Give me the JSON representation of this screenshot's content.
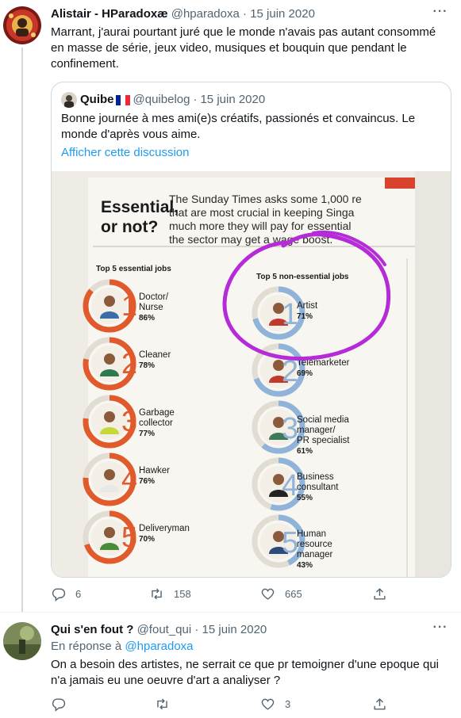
{
  "tweet1": {
    "name": "Alistair - HParadoxæ",
    "handle": "@hparadoxa",
    "separator": "·",
    "date": "15 juin 2020",
    "text": "Marrant, j'aurai pourtant juré que le monde n'avais pas autant consommé en masse de série, jeux video, musiques et bouquin que pendant le confinement.",
    "more_icon": "more-icon",
    "quote": {
      "name": "Quibe",
      "handle": "@quibelog",
      "separator": "·",
      "date": "15 juin 2020",
      "text": "Bonne journée à mes ami(e)s créatifs, passionés et convaincus. Le monde d'après vous aime.",
      "link": "Afficher cette discussion",
      "image": {
        "headline_line1": "Essential,",
        "headline_line2": "or not?",
        "intro": [
          "The Sunday Times asks some 1,000 re",
          "that are most crucial in keeping Singa",
          "much more they will pay for essential",
          "the sector may get a wage boost."
        ],
        "left_title": "Top 5 essential jobs",
        "right_title": "Top 5 non-essential jobs",
        "essential": [
          {
            "rank": "1",
            "job": [
              "Doctor/",
              "Nurse"
            ],
            "pct": "86%",
            "pct_value": 86
          },
          {
            "rank": "2",
            "job": [
              "Cleaner"
            ],
            "pct": "78%",
            "pct_value": 78
          },
          {
            "rank": "3",
            "job": [
              "Garbage",
              "collector"
            ],
            "pct": "77%",
            "pct_value": 77
          },
          {
            "rank": "4",
            "job": [
              "Hawker"
            ],
            "pct": "76%",
            "pct_value": 76
          },
          {
            "rank": "5",
            "job": [
              "Deliveryman"
            ],
            "pct": "70%",
            "pct_value": 70
          }
        ],
        "non_essential": [
          {
            "rank": "1",
            "job": [
              "Artist"
            ],
            "pct": "71%",
            "pct_value": 71
          },
          {
            "rank": "2",
            "job": [
              "Telemarketer"
            ],
            "pct": "69%",
            "pct_value": 69
          },
          {
            "rank": "3",
            "job": [
              "Social media",
              "manager/",
              "PR specialist"
            ],
            "pct": "61%",
            "pct_value": 61
          },
          {
            "rank": "4",
            "job": [
              "Business",
              "consultant"
            ],
            "pct": "55%",
            "pct_value": 55
          },
          {
            "rank": "5",
            "job": [
              "Human",
              "resource",
              "manager"
            ],
            "pct": "43%",
            "pct_value": 43
          }
        ],
        "colors": {
          "essential": "#e05a2b",
          "non_essential": "#8fb3d9",
          "highlight": "#b52bd8"
        }
      }
    },
    "actions": {
      "reply": "6",
      "retweet": "158",
      "like": "665"
    }
  },
  "tweet2": {
    "name": "Qui s'en fout ?",
    "handle": "@fout_qui",
    "separator": "·",
    "date": "15 juin 2020",
    "reply_prefix": "En réponse à",
    "reply_handle": "@hparadoxa",
    "text": "On a besoin des artistes, ne serrait ce que pr temoigner d'une epoque qui n'a jamais eu une oeuvre d'art a analiyser ?",
    "actions": {
      "reply": "",
      "retweet": "",
      "like": "3"
    }
  },
  "colors": {
    "link": "#1d9bf0",
    "muted": "#536471",
    "border": "#cfd9de"
  }
}
